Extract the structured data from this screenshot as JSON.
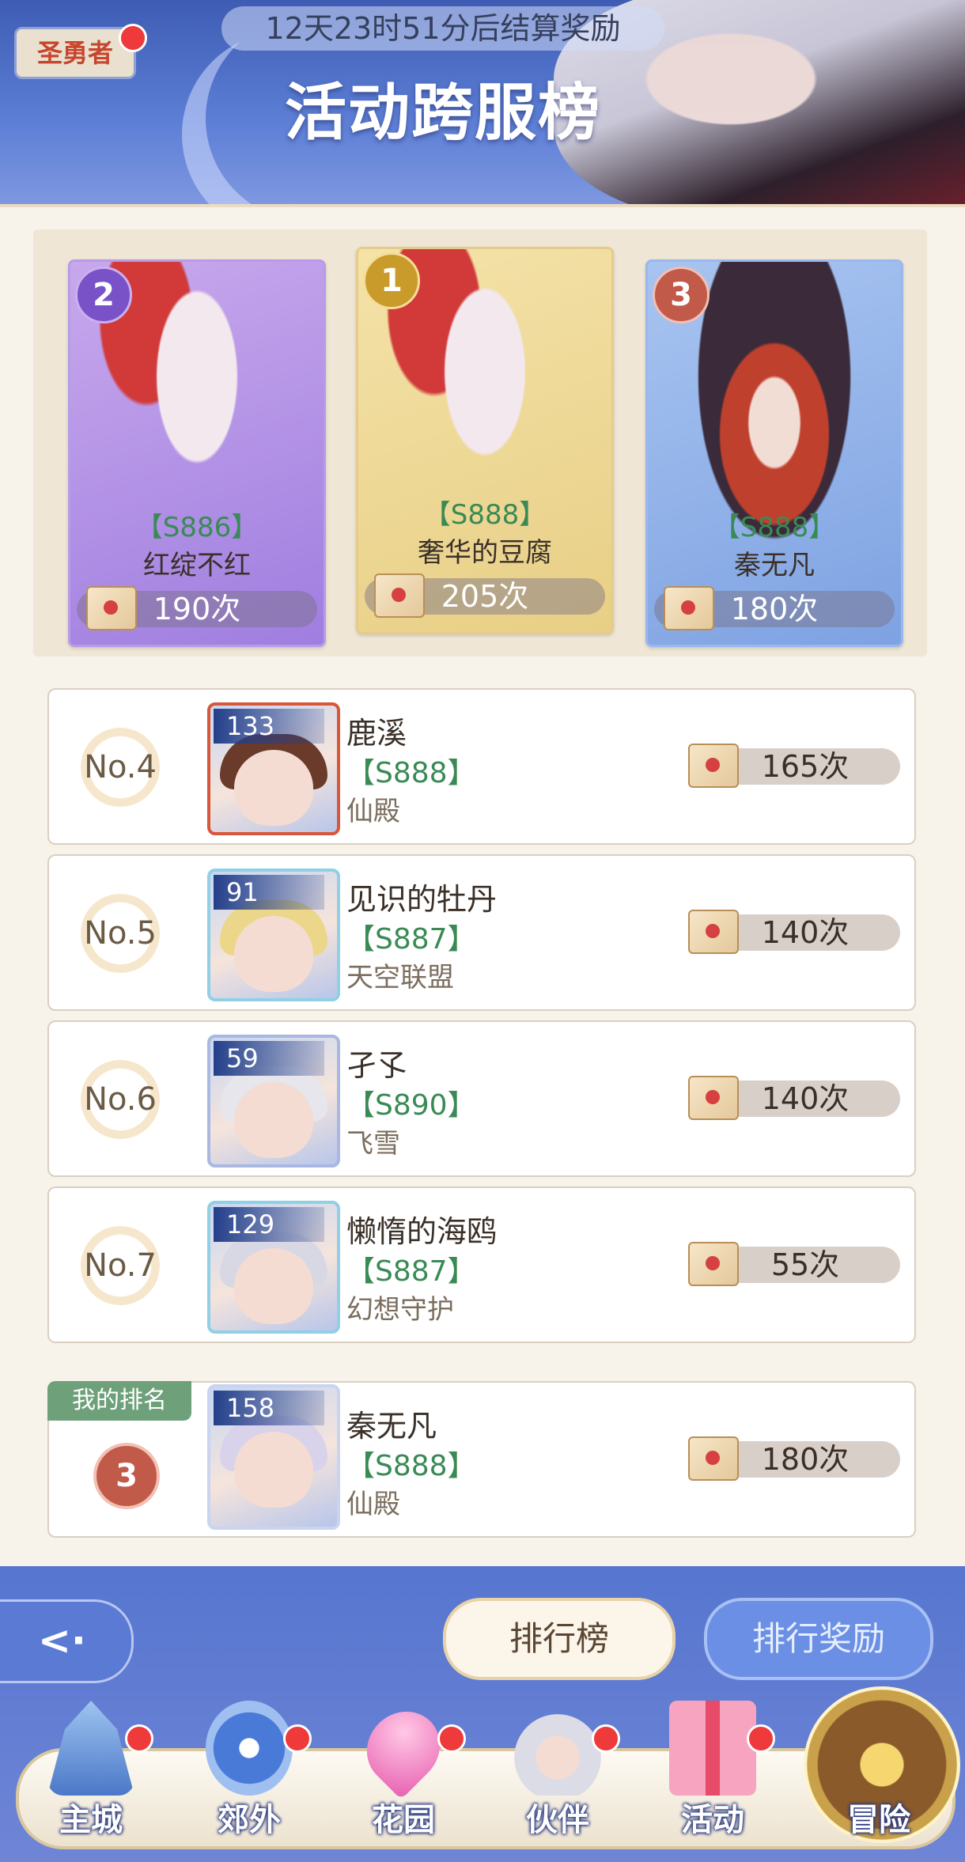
{
  "header": {
    "countdown": "12天23时51分后结算奖励",
    "title": "活动跨服榜",
    "badge": "圣勇者"
  },
  "podium": [
    {
      "rank": "2",
      "server": "【S886】",
      "name": "红绽不红",
      "score": "190次",
      "theme": "purple"
    },
    {
      "rank": "1",
      "server": "【S888】",
      "name": "奢华的豆腐",
      "score": "205次",
      "theme": "gold"
    },
    {
      "rank": "3",
      "server": "【S888】",
      "name": "秦无凡",
      "score": "180次",
      "theme": "blue"
    }
  ],
  "rows": [
    {
      "rank": "No.4",
      "level": "133",
      "name": "鹿溪",
      "server": "【S888】",
      "guild": "仙殿",
      "score": "165次"
    },
    {
      "rank": "No.5",
      "level": "91",
      "name": "见识的牡丹",
      "server": "【S887】",
      "guild": "天空联盟",
      "score": "140次"
    },
    {
      "rank": "No.6",
      "level": "59",
      "name": "孑孓",
      "server": "【S890】",
      "guild": "飞雪",
      "score": "140次"
    },
    {
      "rank": "No.7",
      "level": "129",
      "name": "懒惰的海鸥",
      "server": "【S887】",
      "guild": "幻想守护",
      "score": "55次"
    }
  ],
  "my_rank": {
    "tag": "我的排名",
    "rank": "3",
    "level": "158",
    "name": "秦无凡",
    "server": "【S888】",
    "guild": "仙殿",
    "score": "180次"
  },
  "buttons": {
    "back": "<·",
    "leaderboard": "排行榜",
    "rewards": "排行奖励"
  },
  "nav": [
    {
      "label": "主城",
      "icon": "castle-icon"
    },
    {
      "label": "郊外",
      "icon": "magic-circle-icon"
    },
    {
      "label": "花园",
      "icon": "heart-icon"
    },
    {
      "label": "伙伴",
      "icon": "partner-icon"
    },
    {
      "label": "活动",
      "icon": "gift-icon"
    },
    {
      "label": "冒险",
      "icon": "compass-icon"
    }
  ],
  "colors": {
    "accent_blue": "#5676cf",
    "server_green": "#3a8a55",
    "alert_red": "#ee3a3a"
  }
}
